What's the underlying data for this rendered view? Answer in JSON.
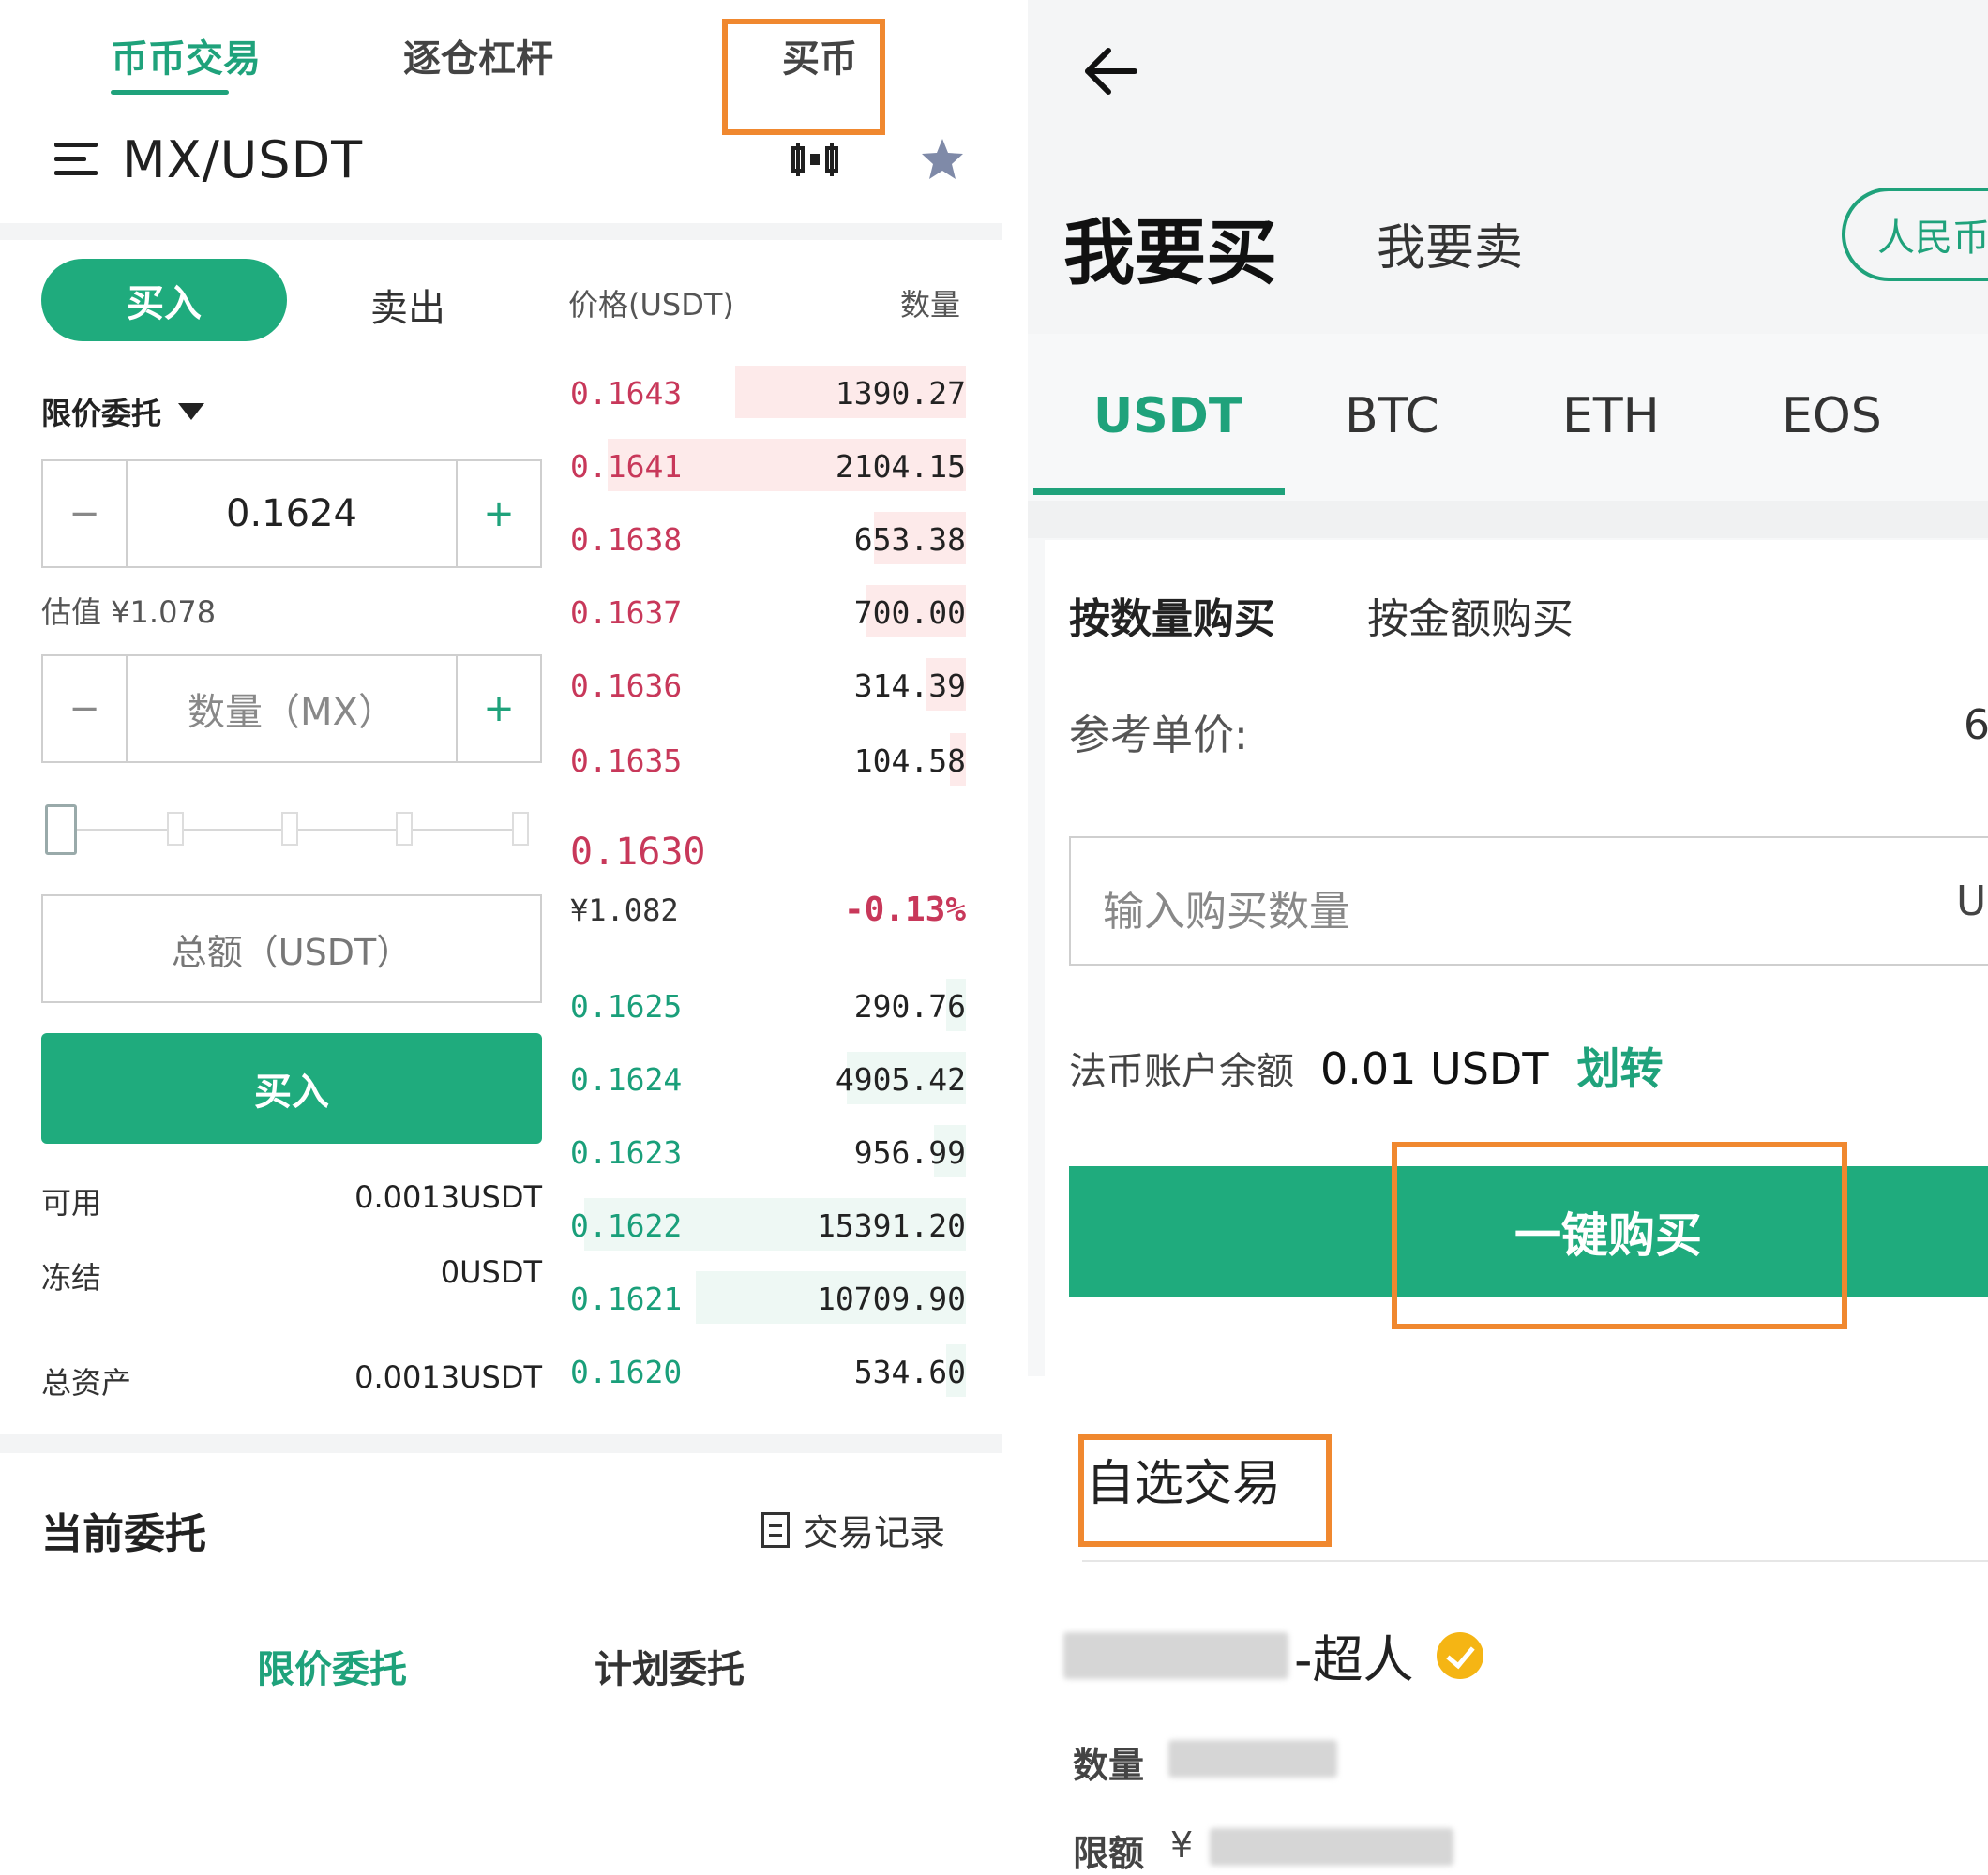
{
  "left": {
    "top_tabs": [
      "币币交易",
      "逐仓杠杆",
      "买币"
    ],
    "pair": "MX/USDT",
    "side_tabs": {
      "buy": "买入",
      "sell": "卖出"
    },
    "book_headers": {
      "price": "价格(USDT)",
      "qty": "数量"
    },
    "order_type": "限价委托",
    "price_input": {
      "value": "0.1624",
      "minus": "−",
      "plus": "+"
    },
    "estimate": "估值 ¥1.078",
    "qty_input": {
      "placeholder": "数量（MX）",
      "minus": "−",
      "plus": "+"
    },
    "total_placeholder": "总额（USDT）",
    "buy_button": "买入",
    "balances": [
      {
        "label": "可用",
        "value": "0.0013USDT"
      },
      {
        "label": "冻结",
        "value": "0USDT"
      },
      {
        "label": "总资产",
        "value": "0.0013USDT"
      }
    ],
    "asks": [
      {
        "price": "0.1643",
        "qty": "1390.27",
        "depth": 0.58
      },
      {
        "price": "0.1641",
        "qty": "2104.15",
        "depth": 0.9
      },
      {
        "price": "0.1638",
        "qty": "653.38",
        "depth": 0.23
      },
      {
        "price": "0.1637",
        "qty": "700.00",
        "depth": 0.25
      },
      {
        "price": "0.1636",
        "qty": "314.39",
        "depth": 0.1
      },
      {
        "price": "0.1635",
        "qty": "104.58",
        "depth": 0.04
      }
    ],
    "last": {
      "price": "0.1630",
      "cny": "¥1.082",
      "change": "-0.13%"
    },
    "bids": [
      {
        "price": "0.1625",
        "qty": "290.76",
        "depth": 0.05
      },
      {
        "price": "0.1624",
        "qty": "4905.42",
        "depth": 0.3
      },
      {
        "price": "0.1623",
        "qty": "956.99",
        "depth": 0.08
      },
      {
        "price": "0.1622",
        "qty": "15391.20",
        "depth": 0.96
      },
      {
        "price": "0.1621",
        "qty": "10709.90",
        "depth": 0.68
      },
      {
        "price": "0.1620",
        "qty": "534.60",
        "depth": 0.05
      }
    ],
    "current_orders": "当前委托",
    "trade_records": "交易记录",
    "order_tabs": [
      "限价委托",
      "计划委托"
    ]
  },
  "right": {
    "buy_title": "我要买",
    "sell_title": "我要卖",
    "currency_pill": "人民币",
    "coins": [
      "USDT",
      "BTC",
      "ETH",
      "EOS"
    ],
    "modes": [
      "按数量购买",
      "按金额购买"
    ],
    "ref_price_label": "参考单价:",
    "ref_price_value": "6",
    "qty_placeholder": "输入购买数量",
    "qty_unit": "U",
    "fiat_label": "法币账户余额",
    "fiat_value": "0.01 USDT",
    "transfer": "划转",
    "one_click": "一键购买",
    "favorites": "自选交易",
    "merchant_suffix": "-超人",
    "qty_label": "数量",
    "limit_label": "限额",
    "limit_prefix": "¥"
  },
  "colors": {
    "accent": "#1fab7d",
    "ask": "#c8385a",
    "highlight": "#f0882f"
  }
}
